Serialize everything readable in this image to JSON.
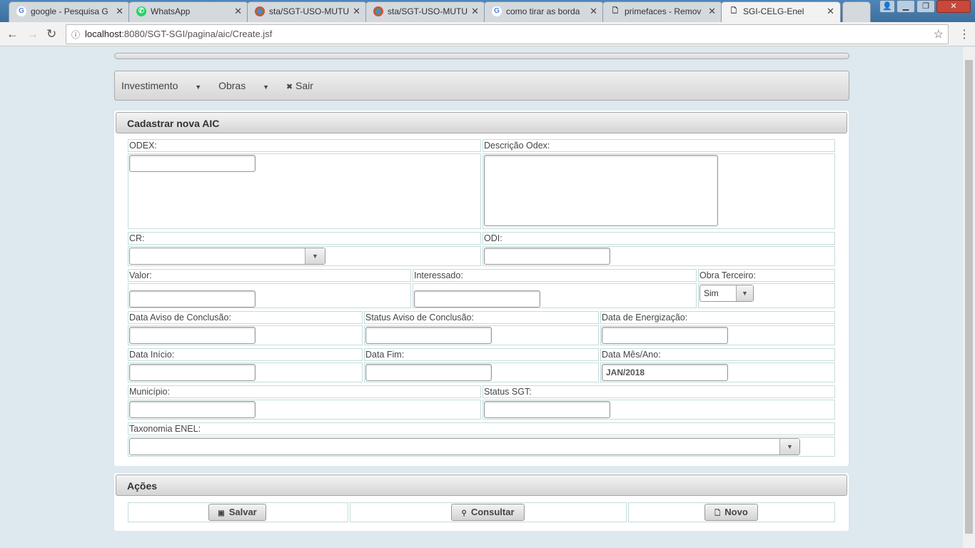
{
  "browser": {
    "tabs": [
      {
        "title": "google - Pesquisa G",
        "icon": "google-icon"
      },
      {
        "title": "WhatsApp",
        "icon": "whatsapp-icon"
      },
      {
        "title": "sta/SGT-USO-MUTU",
        "icon": "chrome-icon"
      },
      {
        "title": "sta/SGT-USO-MUTU",
        "icon": "chrome-icon"
      },
      {
        "title": "como tirar as borda",
        "icon": "google-icon"
      },
      {
        "title": "primefaces - Remov",
        "icon": "page-icon"
      },
      {
        "title": "SGI-CELG-Enel",
        "icon": "page-icon"
      }
    ],
    "url_host": "localhost",
    "url_rest": ":8080/SGT-SGI/pagina/aic/Create.jsf"
  },
  "menu": {
    "items": [
      "Investimento",
      "Obras",
      "Sair"
    ]
  },
  "form": {
    "title": "Cadastrar nova AIC",
    "labels": {
      "odex": "ODEX:",
      "descricao": "Descrição Odex:",
      "cr": "CR:",
      "odi": "ODI:",
      "valor": "Valor:",
      "interessado": "Interessado:",
      "obra_terceiro": "Obra Terceiro:",
      "data_aviso": "Data Aviso de Conclusão:",
      "status_aviso": "Status Aviso de Conclusão:",
      "data_energizacao": "Data de Energização:",
      "data_inicio": "Data Início:",
      "data_fim": "Data Fim:",
      "data_mes_ano": "Data Mês/Ano:",
      "municipio": "Município:",
      "status_sgt": "Status SGT:",
      "taxonomia": "Taxonomia ENEL:"
    },
    "values": {
      "obra_terceiro": "Sim",
      "data_mes_ano": "JAN/2018"
    }
  },
  "actions": {
    "title": "Ações",
    "save": "Salvar",
    "search": "Consultar",
    "new": "Novo"
  }
}
